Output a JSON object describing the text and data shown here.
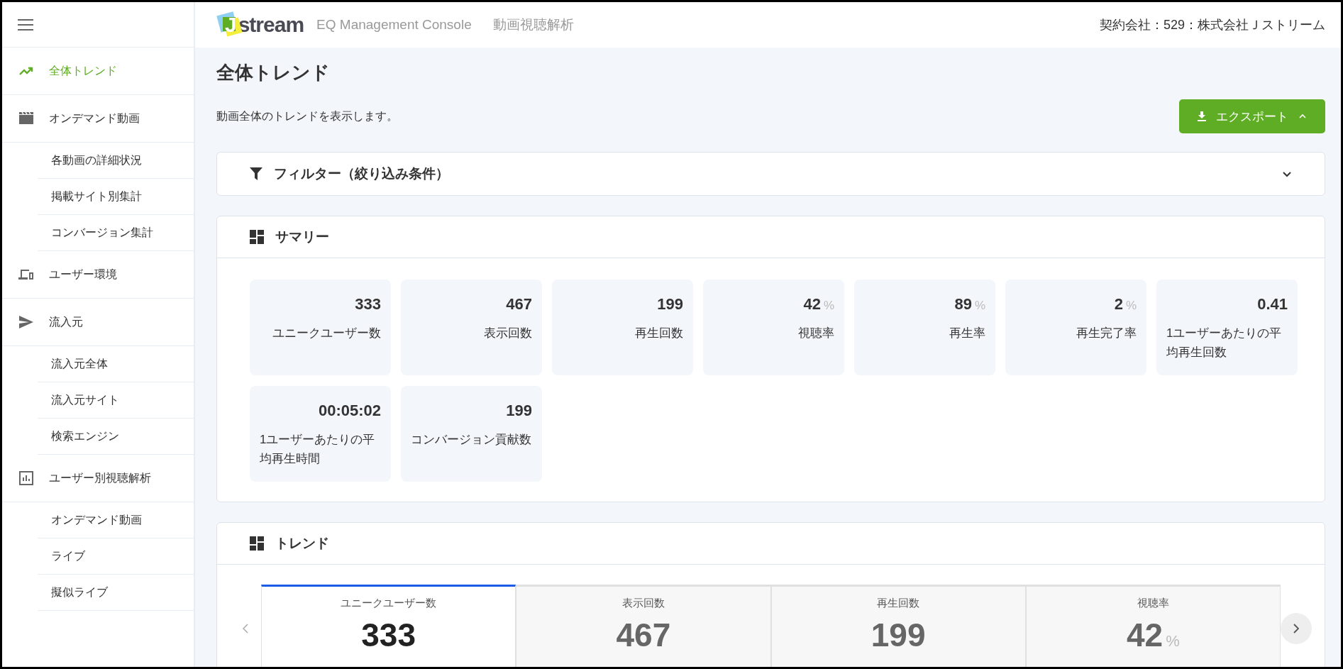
{
  "header": {
    "logo_text": "stream",
    "logo_letter": "J",
    "product": "EQ Management Console",
    "section": "動画視聴解析",
    "account": "契約会社：529：株式会社Ｊストリーム"
  },
  "sidebar": {
    "items": [
      {
        "label": "全体トレンド",
        "selected": true
      },
      {
        "label": "オンデマンド動画",
        "selected": false,
        "children": [
          {
            "label": "各動画の詳細状況",
            "selected": false
          },
          {
            "label": "掲載サイト別集計",
            "selected": false
          },
          {
            "label": "コンバージョン集計",
            "selected": false
          }
        ]
      },
      {
        "label": "ユーザー環境",
        "selected": false
      },
      {
        "label": "流入元",
        "selected": false,
        "children": [
          {
            "label": "流入元全体",
            "selected": false
          },
          {
            "label": "流入元サイト",
            "selected": false
          },
          {
            "label": "検索エンジン",
            "selected": false
          }
        ]
      },
      {
        "label": "ユーザー別視聴解析",
        "selected": false,
        "children": [
          {
            "label": "オンデマンド動画",
            "selected": false
          },
          {
            "label": "ライブ",
            "selected": false
          },
          {
            "label": "擬似ライブ",
            "selected": false
          }
        ]
      }
    ]
  },
  "page": {
    "title": "全体トレンド",
    "description": "動画全体のトレンドを表示します。",
    "export_button": "エクスポート"
  },
  "filter": {
    "title": "フィルター（絞り込み条件）",
    "expanded": false
  },
  "summary": {
    "title": "サマリー",
    "tiles": [
      {
        "value": "333",
        "label": "ユニークユーザー数"
      },
      {
        "value": "467",
        "label": "表示回数"
      },
      {
        "value": "199",
        "label": "再生回数"
      },
      {
        "value": "42",
        "unit": "%",
        "label": "視聴率"
      },
      {
        "value": "89",
        "unit": "%",
        "label": "再生率"
      },
      {
        "value": "2",
        "unit": "%",
        "label": "再生完了率"
      },
      {
        "value": "0.41",
        "label": "1ユーザーあたりの平均再生回数"
      },
      {
        "value": "00:05:02",
        "label": "1ユーザーあたりの平均再生時間"
      },
      {
        "value": "199",
        "label": "コンバージョン貢献数"
      }
    ]
  },
  "trend": {
    "title": "トレンド",
    "tabs": [
      {
        "label": "ユニークユーザー数",
        "value": "333",
        "selected": true
      },
      {
        "label": "表示回数",
        "value": "467",
        "selected": false
      },
      {
        "label": "再生回数",
        "value": "199",
        "selected": false
      },
      {
        "label": "視聴率",
        "value": "42",
        "unit": "%",
        "selected": false
      }
    ]
  }
}
